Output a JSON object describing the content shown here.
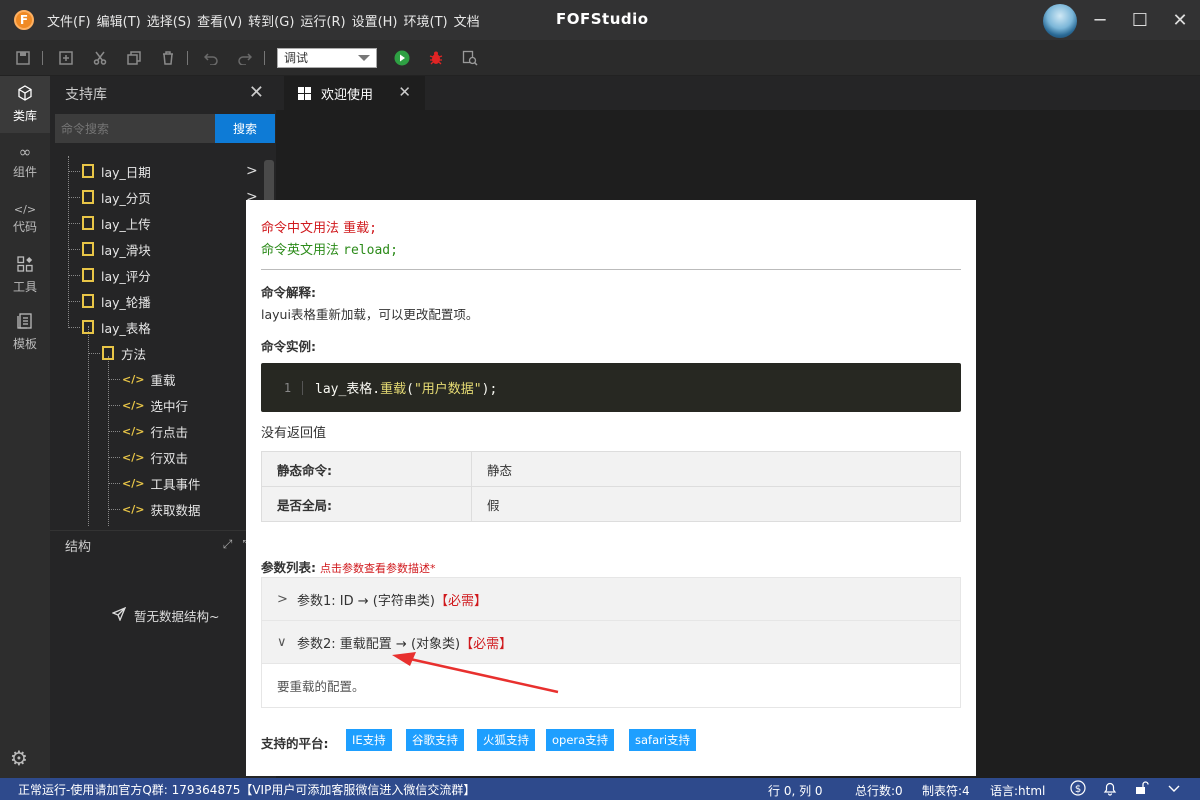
{
  "window": {
    "logo_letter": "F",
    "title": "FOFStudio",
    "menus": [
      "文件(F)",
      "编辑(T)",
      "选择(S)",
      "查看(V)",
      "转到(G)",
      "运行(R)",
      "设置(H)",
      "环境(T)",
      "文档"
    ],
    "controls": {
      "minimize": "─",
      "maximize": "☐",
      "close": "✕"
    }
  },
  "toolbar": {
    "mode_value": "调试",
    "icons": [
      "save-icon",
      "new-file-icon",
      "cut-icon",
      "copy-icon",
      "delete-icon",
      "undo-icon",
      "redo-icon",
      "run-icon",
      "debug-icon",
      "inspect-icon"
    ]
  },
  "activitybar": {
    "items": [
      {
        "icon": "cube-icon",
        "label": "类库",
        "glyph": "⬡"
      },
      {
        "icon": "infinity-icon",
        "label": "组件",
        "glyph": "∞"
      },
      {
        "icon": "code-icon",
        "label": "代码",
        "glyph": "</>"
      },
      {
        "icon": "tools-icon",
        "label": "工具",
        "glyph": "▦"
      },
      {
        "icon": "template-icon",
        "label": "模板",
        "glyph": "▤"
      }
    ],
    "settings_glyph": "⚙"
  },
  "sidepanel": {
    "title": "支持库",
    "close": "✕",
    "search_placeholder": "命令搜索",
    "search_button": "搜索",
    "tree": [
      {
        "label": "lay_日期",
        "type": "folder",
        "level": 0,
        "chevron": ">"
      },
      {
        "label": "lay_分页",
        "type": "folder",
        "level": 0,
        "chevron": ">"
      },
      {
        "label": "lay_上传",
        "type": "folder",
        "level": 0
      },
      {
        "label": "lay_滑块",
        "type": "folder",
        "level": 0
      },
      {
        "label": "lay_评分",
        "type": "folder",
        "level": 0
      },
      {
        "label": "lay_轮播",
        "type": "folder",
        "level": 0
      },
      {
        "label": "lay_表格",
        "type": "folder",
        "level": 0
      },
      {
        "label": "方法",
        "type": "folder",
        "level": 1
      },
      {
        "label": "重载",
        "type": "code",
        "level": 2
      },
      {
        "label": "选中行",
        "type": "code",
        "level": 2
      },
      {
        "label": "行点击",
        "type": "code",
        "level": 2
      },
      {
        "label": "行双击",
        "type": "code",
        "level": 2
      },
      {
        "label": "工具事件",
        "type": "code",
        "level": 2
      },
      {
        "label": "获取数据",
        "type": "code",
        "level": 2
      }
    ],
    "structure_title": "结构",
    "structure_empty": "暂无数据结构~"
  },
  "editor": {
    "tab_label": "欢迎使用",
    "tab_close": "✕"
  },
  "doc": {
    "usage_cn_label": "命令中文用法",
    "usage_cn_value": "重载;",
    "usage_en_label": "命令英文用法",
    "usage_en_value": "reload;",
    "explain_title": "命令解释:",
    "explain_text": "layui表格重新加载，可以更改配置项。",
    "example_title": "命令实例:",
    "code_line_no": "1",
    "code_obj": "lay_表格.",
    "code_func": "重载",
    "code_open": "(",
    "code_str": "\"用户数据\"",
    "code_close": ");",
    "no_return": "没有返回值",
    "props": [
      {
        "key": "静态命令:",
        "value": "静态"
      },
      {
        "key": "是否全局:",
        "value": "假"
      }
    ],
    "params_title": "参数列表:",
    "params_hint": "点击参数查看参数描述*",
    "params": [
      {
        "toggle": ">",
        "text": "参数1: ID → (字符串类)",
        "required": "【必需】",
        "expanded": false
      },
      {
        "toggle": "∨",
        "text": "参数2: 重载配置 → (对象类)",
        "required": "【必需】",
        "expanded": true,
        "desc": "要重载的配置。"
      }
    ],
    "platforms_title": "支持的平台:",
    "platforms": [
      "IE支持",
      "谷歌支持",
      "火狐支持",
      "opera支持",
      "safari支持"
    ],
    "annotation_color": "#e8302e"
  },
  "statusbar": {
    "left": "正常运行-使用请加官方Q群: 179364875【VIP用户可添加客服微信进入微信交流群】",
    "position": "行 0, 列 0",
    "total_lines": "总行数:0",
    "tabs": "制表符:4",
    "language": "语言:html",
    "icons": [
      "dollar-icon",
      "bell-icon",
      "unlock-icon",
      "chevron-down-icon"
    ]
  },
  "colors": {
    "accent": "#0e7bd6",
    "statusbar": "#2e4a8c",
    "folder": "#e8c547",
    "required": "#d0191d",
    "usage_en": "#2c8b1a",
    "tag": "#1e9fff"
  }
}
